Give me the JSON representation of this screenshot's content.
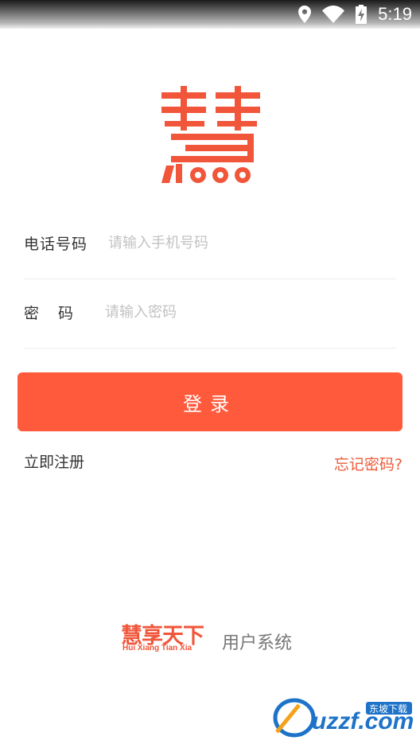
{
  "status_bar": {
    "time": "5:19",
    "icons": [
      "location-icon",
      "wifi-icon",
      "battery-charging-icon"
    ]
  },
  "logo": {
    "char": "慧",
    "color": "#f1553a"
  },
  "form": {
    "phone_label": "电话号码",
    "phone_placeholder": "请输入手机号码",
    "password_label": "密码",
    "password_placeholder": "请输入密码"
  },
  "login_button": {
    "label": "登录",
    "color": "#ff5a3c"
  },
  "links": {
    "register": "立即注册",
    "forgot": "忘记密码?"
  },
  "brand": {
    "name": "慧享天下",
    "pinyin": "Hui Xiang Tian Xia",
    "subtitle": "用户系统"
  },
  "watermark": {
    "text": "uzzf.com",
    "tag": "东坡下载"
  }
}
